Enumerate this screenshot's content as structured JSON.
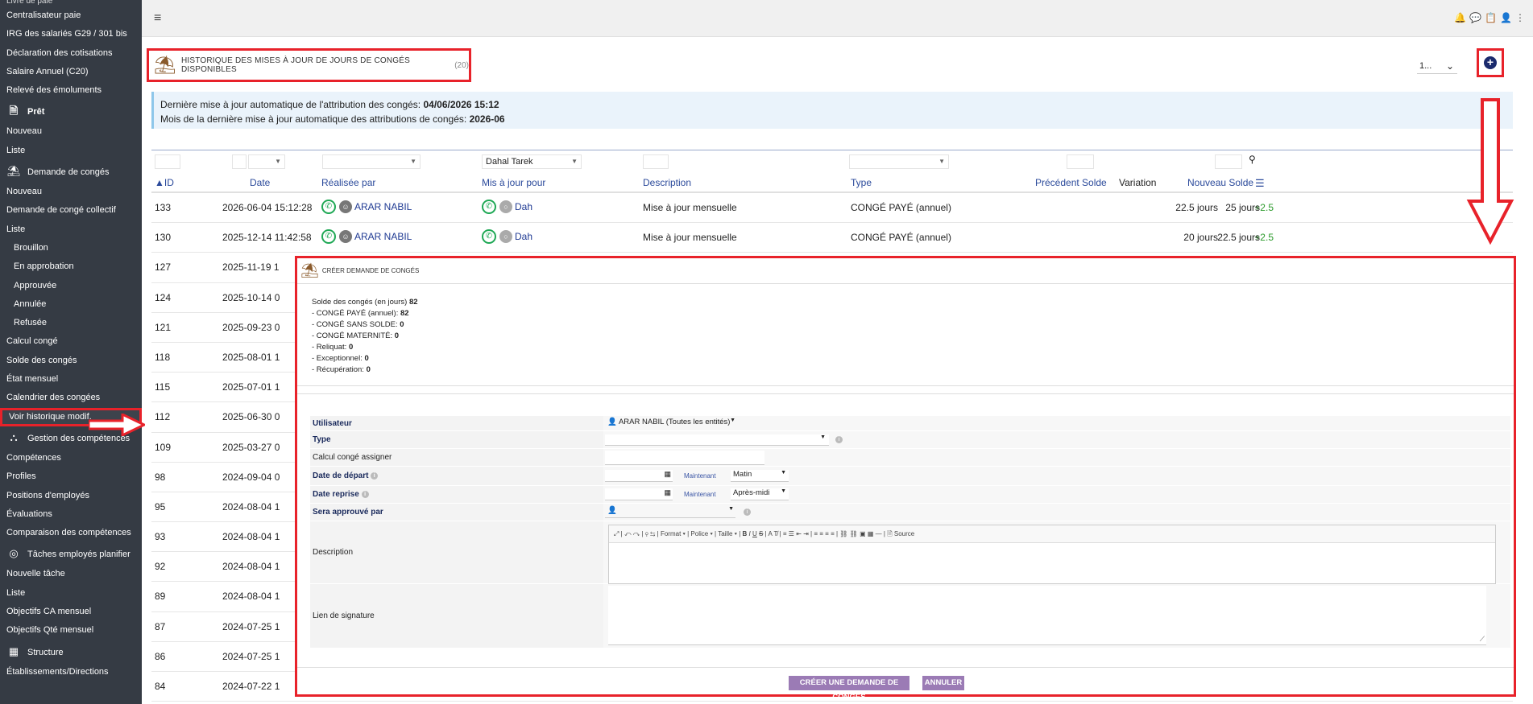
{
  "sidebar": {
    "top_cut": "Livre de paie",
    "items": [
      {
        "label": "Centralisateur paie",
        "kind": "item"
      },
      {
        "label": "IRG des salariés G29 / 301 bis",
        "kind": "item"
      },
      {
        "label": "Déclaration des cotisations",
        "kind": "item"
      },
      {
        "label": "Salaire Annuel (C20)",
        "kind": "item"
      },
      {
        "label": "Relevé des émoluments",
        "kind": "item"
      },
      {
        "label": "Prêt",
        "kind": "header",
        "icon": "document-icon",
        "glyph": "🗎",
        "bold": true
      },
      {
        "label": "Nouveau",
        "kind": "item"
      },
      {
        "label": "Liste",
        "kind": "item"
      },
      {
        "label": "Demande de congés",
        "kind": "header",
        "icon": "beach-umbrella-icon",
        "glyph": "⛱"
      },
      {
        "label": "Nouveau",
        "kind": "item"
      },
      {
        "label": "Demande de congé collectif",
        "kind": "item"
      },
      {
        "label": "Liste",
        "kind": "item"
      },
      {
        "label": "Brouillon",
        "kind": "sub"
      },
      {
        "label": "En approbation",
        "kind": "sub"
      },
      {
        "label": "Approuvée",
        "kind": "sub"
      },
      {
        "label": "Annulée",
        "kind": "sub"
      },
      {
        "label": "Refusée",
        "kind": "sub"
      },
      {
        "label": "Calcul congé",
        "kind": "item"
      },
      {
        "label": "Solde des congés",
        "kind": "item"
      },
      {
        "label": "État mensuel",
        "kind": "item"
      },
      {
        "label": "Calendrier des congées",
        "kind": "item"
      },
      {
        "label": "Voir historique modif.",
        "kind": "highlight"
      },
      {
        "label": "Gestion des compétences",
        "kind": "header",
        "icon": "shapes-icon",
        "glyph": "⛬"
      },
      {
        "label": "Compétences",
        "kind": "item"
      },
      {
        "label": "Profiles",
        "kind": "item"
      },
      {
        "label": "Positions d'employés",
        "kind": "item"
      },
      {
        "label": "Évaluations",
        "kind": "item"
      },
      {
        "label": "Comparaison des compétences",
        "kind": "item"
      },
      {
        "label": "Tâches employés planifier",
        "kind": "header",
        "icon": "target-icon",
        "glyph": "◎"
      },
      {
        "label": "Nouvelle tâche",
        "kind": "item"
      },
      {
        "label": "Liste",
        "kind": "item"
      },
      {
        "label": "Objectifs CA mensuel",
        "kind": "item"
      },
      {
        "label": "Objectifs Qté mensuel",
        "kind": "item"
      },
      {
        "label": "Structure",
        "kind": "header",
        "icon": "building-icon",
        "glyph": "▦"
      },
      {
        "label": "Établissements/Directions",
        "kind": "item"
      }
    ]
  },
  "page": {
    "title": "Historique des mises à jour de jours de congés disponibles",
    "count": "(20)",
    "per_page": "1..."
  },
  "info": {
    "line1_label": "Dernière mise à jour automatique de l'attribution des congés:",
    "line1_value": "04/06/2026 15:12",
    "line2_label": "Mois de la dernière mise à jour automatique des attributions de congés:",
    "line2_value": "2026-06"
  },
  "table": {
    "filter_user": "Dahal Tarek",
    "columns": [
      "ID",
      "Date",
      "Réalisée par",
      "Mis à jour pour",
      "Description",
      "Type",
      "Précédent Solde",
      "Variation",
      "Nouveau Solde"
    ],
    "full_rows": [
      {
        "id": "133",
        "date": "2026-06-04 15:12:28",
        "by": "ARAR NABIL",
        "for": "Dah",
        "desc": "Mise à jour mensuelle",
        "type": "CONGÉ PAYÉ (annuel)",
        "prev": "22.5 jours",
        "var": "+2.5",
        "new": "25 jours"
      },
      {
        "id": "130",
        "date": "2025-12-14 11:42:58",
        "by": "ARAR NABIL",
        "for": "Dah",
        "desc": "Mise à jour mensuelle",
        "type": "CONGÉ PAYÉ (annuel)",
        "prev": "20 jours",
        "var": "+2.5",
        "new": "22.5 jours"
      }
    ],
    "partial_rows": [
      {
        "id": "127",
        "date": "2025-11-19 1"
      },
      {
        "id": "124",
        "date": "2025-10-14 0"
      },
      {
        "id": "121",
        "date": "2025-09-23 0"
      },
      {
        "id": "118",
        "date": "2025-08-01 1"
      },
      {
        "id": "115",
        "date": "2025-07-01 1"
      },
      {
        "id": "112",
        "date": "2025-06-30 0"
      },
      {
        "id": "109",
        "date": "2025-03-27 0"
      },
      {
        "id": "98",
        "date": "2024-09-04 0"
      },
      {
        "id": "95",
        "date": "2024-08-04 1"
      },
      {
        "id": "93",
        "date": "2024-08-04 1"
      },
      {
        "id": "92",
        "date": "2024-08-04 1"
      },
      {
        "id": "89",
        "date": "2024-08-04 1"
      },
      {
        "id": "87",
        "date": "2024-07-25 1"
      },
      {
        "id": "86",
        "date": "2024-07-25 1"
      },
      {
        "id": "84",
        "date": "2024-07-22 1"
      }
    ]
  },
  "modal": {
    "title": "Créer demande de congés",
    "solde_label": "Solde des congés (en jours)",
    "solde_total": "82",
    "solde_lines": [
      {
        "label": "- CONGÉ PAYÉ (annuel):",
        "value": "82"
      },
      {
        "label": "- CONGÉ SANS SOLDE:",
        "value": "0"
      },
      {
        "label": "- CONGÉ MATERNITÉ:",
        "value": "0"
      },
      {
        "label": "- Reliquat:",
        "value": "0"
      },
      {
        "label": "- Exceptionnel:",
        "value": "0"
      },
      {
        "label": "- Récupération:",
        "value": "0"
      }
    ],
    "form": {
      "user_label": "Utilisateur",
      "user_value": "ARAR NABIL (Toutes les entités)",
      "type_label": "Type",
      "calc_label": "Calcul congé assigner",
      "start_label": "Date de départ",
      "start_now": "Maintenant",
      "start_period": "Matin",
      "end_label": "Date reprise",
      "end_now": "Maintenant",
      "end_period": "Après-midi",
      "approver_label": "Sera approuvé par",
      "desc_label": "Description",
      "editor_toolbar": [
        "Format",
        "Police",
        "Taille",
        "Source"
      ],
      "sign_label": "Lien de signature"
    },
    "buttons": {
      "create": "Créer une demande de congés",
      "cancel": "Annuler"
    }
  },
  "colors": {
    "sidebar": "#353b44",
    "highlight": "#e8222a",
    "link": "#1f3a93",
    "button": "#9b7bb5"
  }
}
